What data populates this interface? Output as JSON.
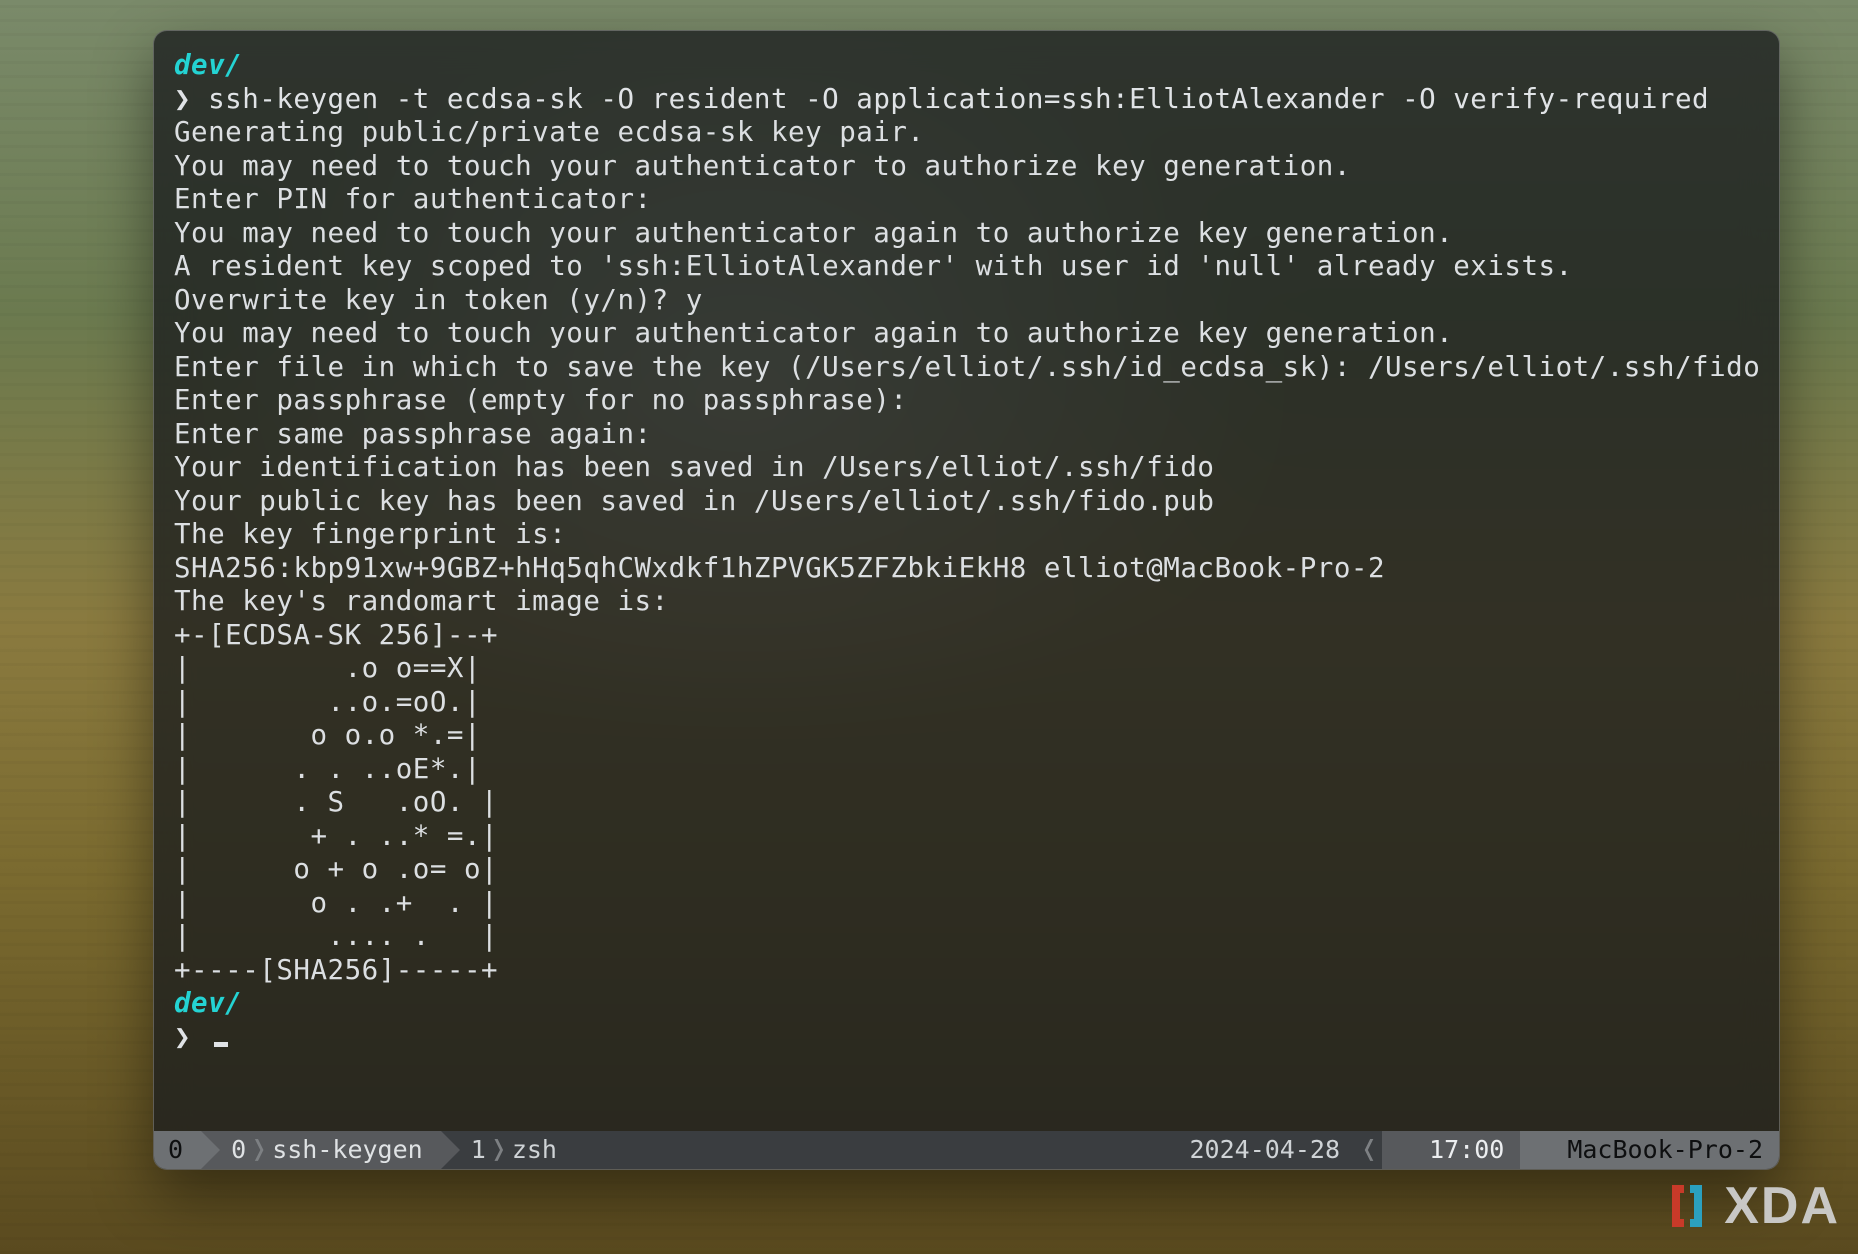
{
  "terminal": {
    "cwd1": "dev/",
    "prompt1": "❯",
    "command": "ssh-keygen -t ecdsa-sk -O resident -O application=ssh:ElliotAlexander -O verify-required",
    "lines": [
      "Generating public/private ecdsa-sk key pair.",
      "You may need to touch your authenticator to authorize key generation.",
      "Enter PIN for authenticator:",
      "You may need to touch your authenticator again to authorize key generation.",
      "A resident key scoped to 'ssh:ElliotAlexander' with user id 'null' already exists.",
      "Overwrite key in token (y/n)? y",
      "You may need to touch your authenticator again to authorize key generation.",
      "Enter file in which to save the key (/Users/elliot/.ssh/id_ecdsa_sk): /Users/elliot/.ssh/fido",
      "Enter passphrase (empty for no passphrase):",
      "Enter same passphrase again:",
      "Your identification has been saved in /Users/elliot/.ssh/fido",
      "Your public key has been saved in /Users/elliot/.ssh/fido.pub",
      "The key fingerprint is:",
      "SHA256:kbp91xw+9GBZ+hHq5qhCWxdkf1hZPVGK5ZFZbkiEkH8 elliot@MacBook-Pro-2",
      "The key's randomart image is:",
      "+-[ECDSA-SK 256]--+",
      "|         .o o==X|",
      "|        ..o.=oO.|",
      "|       o o.o *.=|",
      "|      . . ..oE*.|",
      "|      . S   .oO. |",
      "|       + . ..* =.|",
      "|      o + o .o= o|",
      "|       o . .+  . |",
      "|        .... .   |",
      "+----[SHA256]-----+"
    ],
    "cwd2": "dev/",
    "prompt2": "❯"
  },
  "statusbar": {
    "session": "0",
    "window_index": "0",
    "window_name": "ssh-keygen",
    "pane_index": "1",
    "pane_name": "zsh",
    "date": "2024-04-28",
    "time": "17:00",
    "host": "MacBook-Pro-2"
  },
  "watermark": {
    "brand": "XDA"
  }
}
